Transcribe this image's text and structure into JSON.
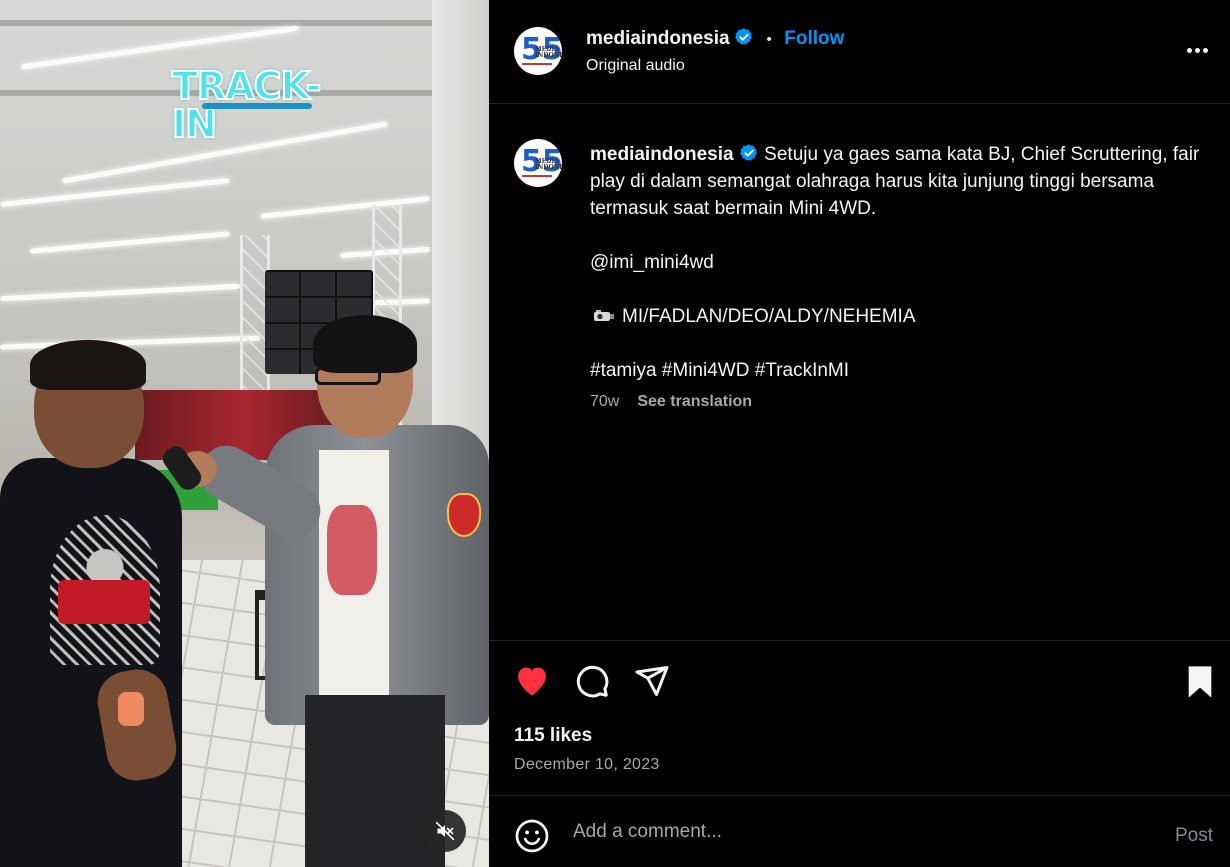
{
  "video": {
    "overlay_logo": "TRACK-IN",
    "mute_icon": "speaker-muted-icon"
  },
  "post": {
    "account": {
      "username": "mediaindonesia",
      "verified": true,
      "verified_color": "#0095f6",
      "follow_label": "Follow",
      "audio": "Original audio",
      "avatar_number": "55",
      "avatar_text": "MEDIA INDONESIA"
    },
    "caption": {
      "username": "mediaindonesia",
      "text": "Setuju ya gaes sama kata BJ, Chief Scruttering, fair play di dalam semangat olahraga harus kita junjung tinggi bersama termasuk saat bermain Mini 4WD.",
      "mention": "@imi_mini4wd",
      "credit_icon": "camera-emoji",
      "credit": "MI/FADLAN/DEO/ALDY/NEHEMIA",
      "hashtags": "#tamiya #Mini4WD #TrackInMI"
    },
    "time_ago": "70w",
    "see_translation": "See translation",
    "likes": "115 likes",
    "date": "December 10, 2023",
    "liked": true,
    "like_color": "#ff3040",
    "comment_placeholder": "Add a comment...",
    "post_label": "Post"
  }
}
